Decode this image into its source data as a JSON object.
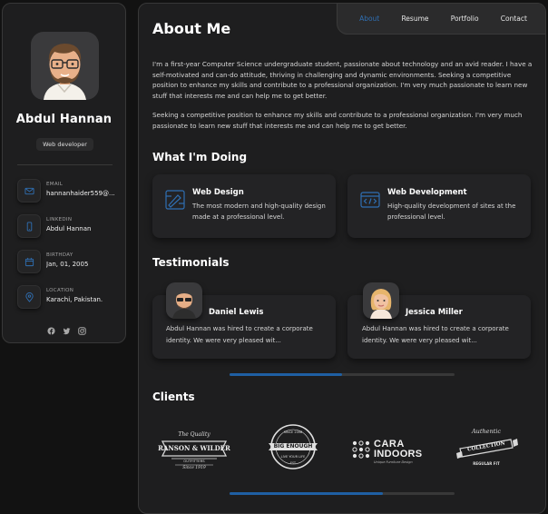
{
  "sidebar": {
    "name": "Abdul Hannan",
    "title": "Web developer",
    "contacts": [
      {
        "label": "EMAIL",
        "value": "hannanhaider559@...",
        "icon": "mail-icon"
      },
      {
        "label": "LINKEDIN",
        "value": "Abdul Hannan",
        "icon": "phone-icon"
      },
      {
        "label": "BIRTHDAY",
        "value": "Jan, 01, 2005",
        "icon": "calendar-icon"
      },
      {
        "label": "LOCATION",
        "value": "Karachi, Pakistan.",
        "icon": "location-icon"
      }
    ],
    "socials": [
      "facebook-icon",
      "twitter-icon",
      "instagram-icon"
    ]
  },
  "nav": {
    "items": [
      "About",
      "Resume",
      "Portfolio",
      "Contact"
    ],
    "active": "About"
  },
  "about": {
    "title": "About Me",
    "p1": "I'm a first-year Computer Science undergraduate student, passionate about technology and an avid reader. I have a self-motivated and can-do attitude, thriving in challenging and dynamic environments. Seeking a competitive position to enhance my skills and contribute to a professional organization. I'm very much passionate to learn new stuff that interests me and can help me to get better.",
    "p2": "Seeking a competitive position to enhance my skills and contribute to a professional organization. I'm very much passionate to learn new stuff that interests me and can help me to get better."
  },
  "doing": {
    "title": "What I'm Doing",
    "services": [
      {
        "title": "Web Design",
        "desc": "The most modern and high-quality design made at a professional level."
      },
      {
        "title": "Web Development",
        "desc": "High-quality development of sites at the professional level."
      }
    ]
  },
  "testimonials": {
    "title": "Testimonials",
    "items": [
      {
        "name": "Daniel Lewis",
        "text": "Abdul Hannan was hired to create a corporate identity. We were very pleased wit..."
      },
      {
        "name": "Jessica Miller",
        "text": "Abdul Hannan was hired to create a corporate identity. We were very pleased wit..."
      }
    ],
    "scroll_fraction": 0.5
  },
  "clients": {
    "title": "Clients",
    "logos": [
      {
        "top": "The Quality",
        "main": "RANSON & WILDER",
        "sub": "OUTFITTERS",
        "foot": "Since 1919"
      },
      {
        "top": "SINCE 2008",
        "main": "BIG ENOUGH",
        "sub": "LIVE YOUR LIFE",
        "foot": "EST"
      },
      {
        "main": "CARA",
        "main2": "INDOORS",
        "sub": "Unique Furniture Design"
      },
      {
        "top": "Authentic",
        "main": "COLLECTION",
        "sub": "REGULAR FIT"
      }
    ],
    "scroll_fraction": 0.68
  },
  "colors": {
    "accent": "#2f6fb3",
    "card": "#232325",
    "bg": "#121212"
  }
}
